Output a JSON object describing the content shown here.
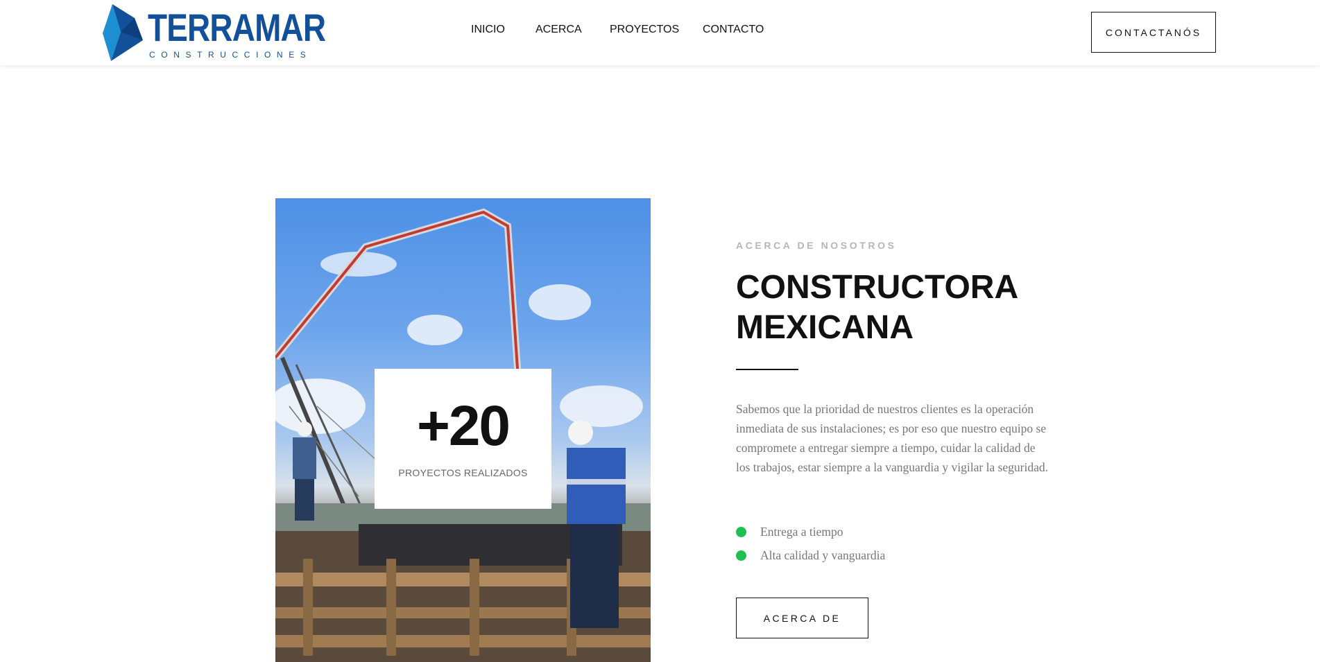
{
  "header": {
    "logo": {
      "name": "TERRAMAR",
      "tagline": "CONSTRUCCIONES",
      "brand_color": "#12509a",
      "accent_color": "#1b8fd0"
    },
    "nav": [
      {
        "label": "INICIO"
      },
      {
        "label": "ACERCA"
      },
      {
        "label": "PROYECTOS"
      },
      {
        "label": "CONTACTO"
      }
    ],
    "cta_label": "CONTACTANÓS"
  },
  "about": {
    "image_icon": "construction-site-photo",
    "stat": {
      "value": "+20",
      "label": "PROYECTOS REALIZADOS"
    },
    "eyebrow": "ACERCA DE NOSOTROS",
    "title_lines": [
      "CONSTRUCTORA",
      "MEXICANA"
    ],
    "description": "Sabemos que la prioridad de nuestros clientes es la operación inmediata de sus instalaciones; es por eso que nuestro equipo se compromete a entregar siempre a tiempo, cuidar la calidad de los trabajos, estar siempre a la vanguardia y vigilar la seguridad.",
    "bullets": [
      {
        "label": "Entrega a tiempo"
      },
      {
        "label": "Alta calidad y vanguardia"
      }
    ],
    "bullet_color": "#1ec050",
    "cta_label": "ACERCA DE"
  }
}
